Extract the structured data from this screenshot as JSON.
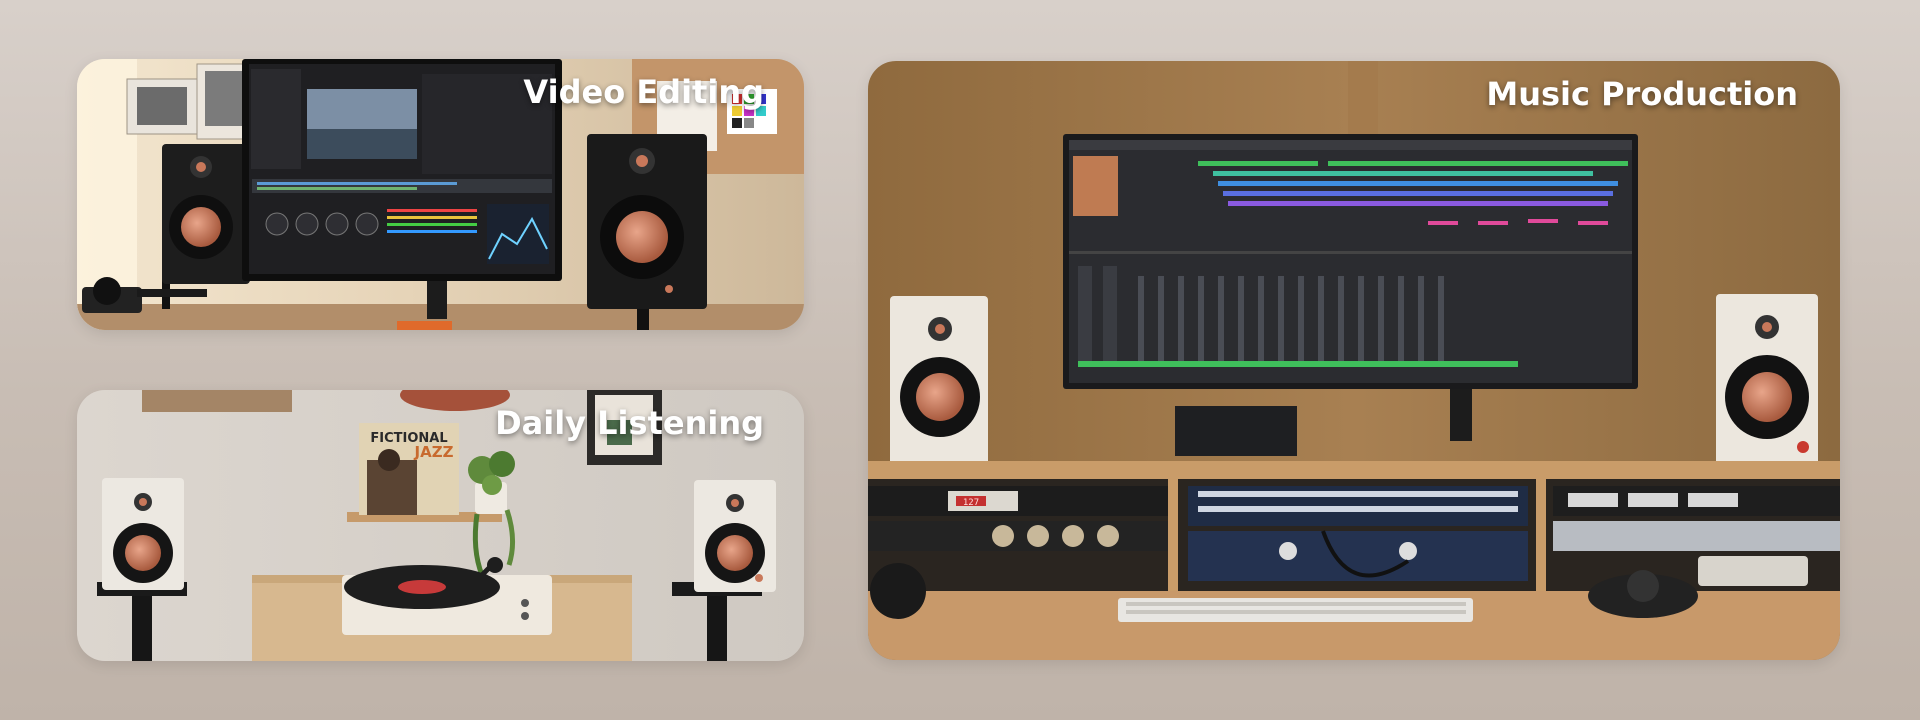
{
  "cards": {
    "video_editing": {
      "title": "Video Editing"
    },
    "daily_listening": {
      "title": "Daily Listening",
      "album_text_1": "FICTIONAL",
      "album_text_2": "JAZZ"
    },
    "music_production": {
      "title": "Music Production",
      "rack_display": "127"
    }
  },
  "colors": {
    "page_background": "#d3cac3",
    "title_text": "#ffffff",
    "speaker_cone": "#c9785a",
    "speaker_black": "#1c1c1c",
    "speaker_white": "#eeeae3"
  },
  "icons": [
    "speaker-icon",
    "monitor-icon",
    "turntable-icon",
    "plant-icon",
    "keyboard-icon"
  ]
}
